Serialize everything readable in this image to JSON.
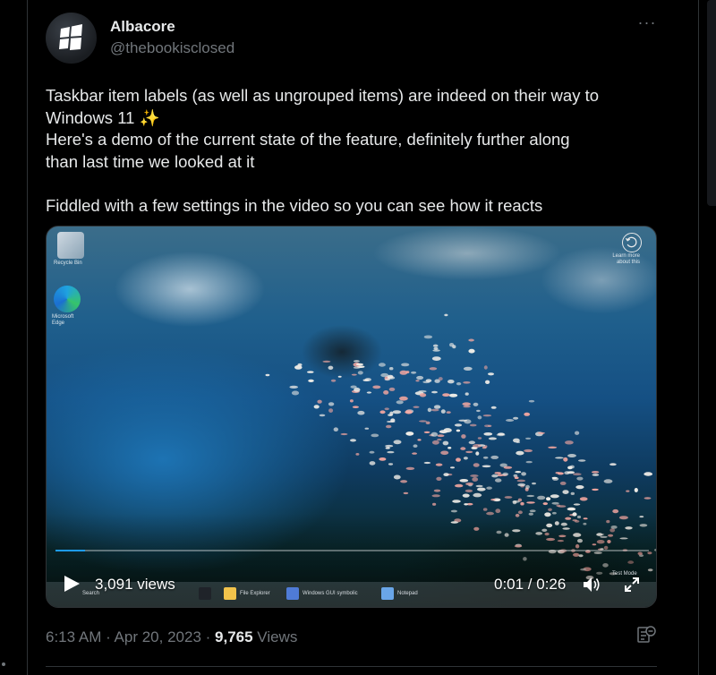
{
  "author": {
    "display_name": "Albacore",
    "handle": "@thebookisclosed"
  },
  "more_icon": "more-horizontal-icon",
  "tweet": {
    "lines": [
      "Taskbar item labels (as well as ungrouped items) are indeed on their way to",
      "Windows 11",
      "Here's a demo of the current state of the feature, definitely further along",
      "than last time we looked at it",
      "Fiddled with a few settings in the video so you can see how it reacts"
    ],
    "emoji": "✨"
  },
  "video": {
    "views_label": "3,091 views",
    "time_label": "0:01 / 0:26",
    "progress": 0.05,
    "desktop": {
      "recycle_label": "Recycle Bin",
      "edge_label": "Microsoft Edge",
      "top_right_text": "Learn more about this",
      "taskbar_items": [
        "Search",
        "File Explorer",
        "Windows GUI symbolic",
        "Notepad"
      ],
      "test_mode_text": "Test Mode"
    },
    "icons": {
      "play": "play-icon",
      "volume": "volume-icon",
      "fullscreen": "fullscreen-icon",
      "replay": "replay-icon"
    }
  },
  "footer": {
    "timestamp": "6:13 AM · Apr 20, 2023 ·",
    "view_count": "9,765",
    "views_word": "Views",
    "analytics_icon": "analytics-icon"
  },
  "colors": {
    "background": "#000000",
    "text": "#e7e9ea",
    "muted": "#71767b",
    "accent": "#1d9bf0",
    "border": "#2f3336"
  }
}
